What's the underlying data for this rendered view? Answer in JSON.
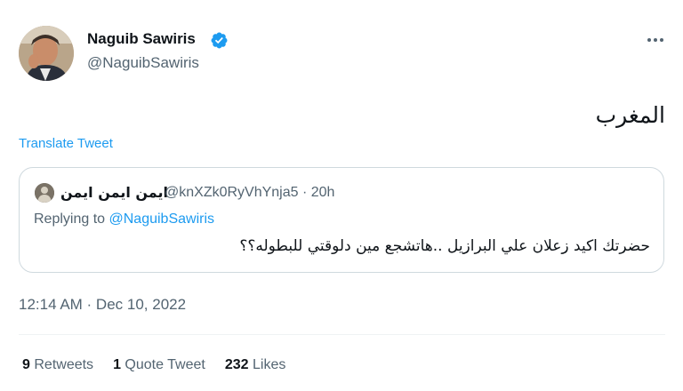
{
  "author": {
    "name": "Naguib Sawiris",
    "handle": "@NaguibSawiris",
    "avatar_icon": "profile-photo",
    "verified_icon": "verified-badge-icon"
  },
  "tweet": {
    "text": "المغرب",
    "translate_label": "Translate Tweet",
    "timestamp": "12:14 AM · Dec 10, 2022"
  },
  "quoted": {
    "name": "ايمن ايمن ايمن",
    "handle_time": "@knXZk0RyVhYnja5 · 20h",
    "replying_prefix": "Replying to ",
    "replying_to": "@NaguibSawiris",
    "text": "حضرتك اكيد زعلان علي البرازيل ..هاتشجع مين دلوقتي للبطوله؟؟"
  },
  "stats": {
    "retweets_count": "9",
    "retweets_label": "Retweets",
    "quotes_count": "1",
    "quotes_label": "Quote Tweet",
    "likes_count": "232",
    "likes_label": "Likes"
  },
  "colors": {
    "accent": "#1d9bf0",
    "secondary_text": "#536471",
    "primary_text": "#0f1419",
    "border": "#cfd9de"
  }
}
